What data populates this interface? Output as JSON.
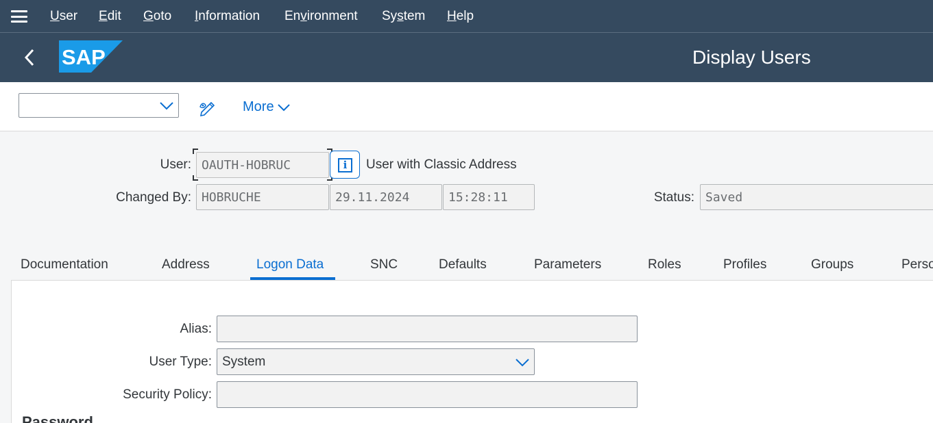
{
  "menu": {
    "items": [
      {
        "label_mn": "U",
        "label_rest": "ser"
      },
      {
        "label_mn": "E",
        "label_rest": "dit"
      },
      {
        "label_mn": "G",
        "label_rest": "oto"
      },
      {
        "label_mn": "I",
        "label_rest": "nformation"
      },
      {
        "label_pre": "En",
        "label_mn": "v",
        "label_rest": "ironment"
      },
      {
        "label_pre": "Sy",
        "label_mn": "s",
        "label_rest": "tem"
      },
      {
        "label_mn": "H",
        "label_rest": "elp"
      }
    ]
  },
  "shell": {
    "title": "Display Users",
    "logo_text": "SAP"
  },
  "toolbar": {
    "command_field_value": "",
    "more_label": "More"
  },
  "header": {
    "user_label": "User:",
    "user_value": "OAUTH-HOBRUC",
    "user_type_text": "User with Classic Address",
    "changed_by_label": "Changed By:",
    "changed_by_value": "HOBRUCHE",
    "changed_date": "29.11.2024",
    "changed_time": "15:28:11",
    "status_label": "Status:",
    "status_value": "Saved"
  },
  "tabs": [
    {
      "label": "Documentation"
    },
    {
      "label": "Address"
    },
    {
      "label": "Logon Data"
    },
    {
      "label": "SNC"
    },
    {
      "label": "Defaults"
    },
    {
      "label": "Parameters"
    },
    {
      "label": "Roles"
    },
    {
      "label": "Profiles"
    },
    {
      "label": "Groups"
    },
    {
      "label": "Personalization"
    }
  ],
  "active_tab": "Logon Data",
  "logon": {
    "alias_label": "Alias:",
    "alias_value": "",
    "user_type_label": "User Type:",
    "user_type_value": "System",
    "security_policy_label": "Security Policy:",
    "security_policy_value": "",
    "password_section_partial": "Password"
  },
  "colors": {
    "shell_bg": "#354a5f",
    "accent": "#0a6ed1",
    "sap_logo_blue": "#1a9be8"
  }
}
